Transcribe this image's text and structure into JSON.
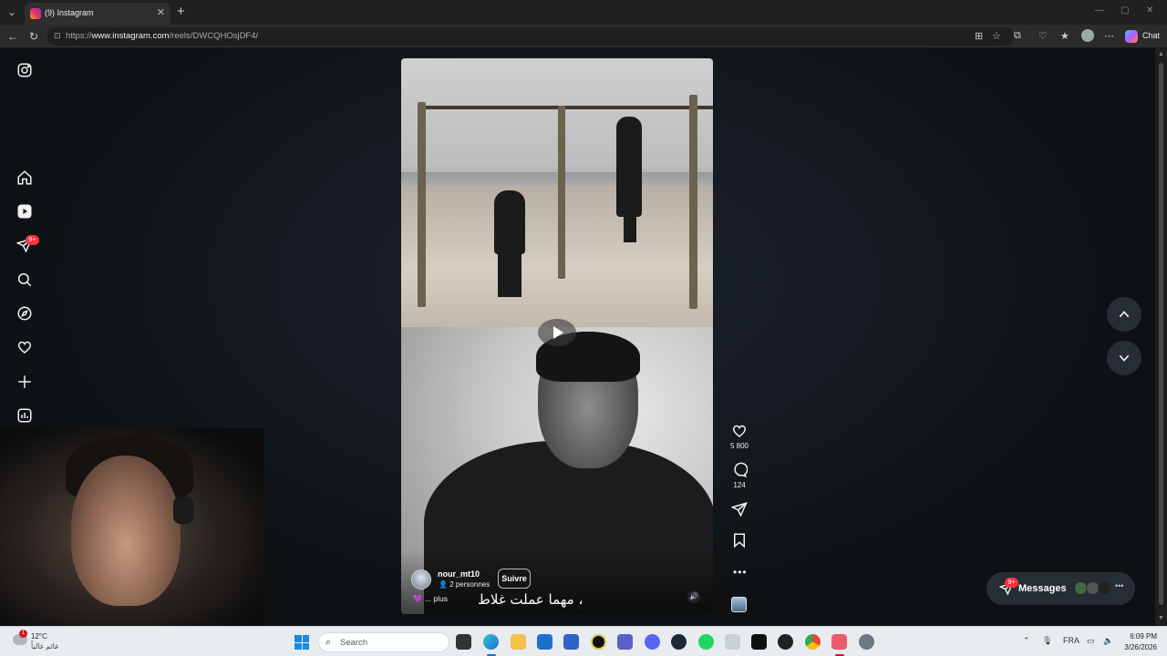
{
  "browser": {
    "tab_title": "(9) Instagram",
    "tab_close": "✕",
    "new_tab": "+",
    "url_prefix": "https://",
    "url_host": "www.instagram.com",
    "url_path": "/reels/DWCQHOsjDF4/",
    "chat_label": "Chat"
  },
  "sidebar": {
    "notification_badge": "9+",
    "items": [
      "instagram-logo",
      "home",
      "reels",
      "direct",
      "search",
      "explore",
      "notifications",
      "create",
      "dashboard",
      "profile"
    ]
  },
  "reel": {
    "username": "nour_mt10",
    "followed_by": "2 personnes",
    "follow_label": "Suivre",
    "more_label": "... plus",
    "caption": "مهما عملت غلاط ،",
    "likes": "5 800",
    "comments": "124",
    "sound_icon": "speaker-icon"
  },
  "messages": {
    "label": "Messages",
    "badge": "9+",
    "more": "•••"
  },
  "taskbar": {
    "weather_temp": "12°C",
    "weather_desc": "غائم غالباً",
    "weather_badge": "1",
    "search_placeholder": "Search",
    "language": "FRA",
    "time": "6:09 PM",
    "date": "3/26/2026"
  },
  "colors": {
    "accent": "#ff3040",
    "page_bg": "#0d1114",
    "taskbar_bg": "#e8ecef"
  }
}
